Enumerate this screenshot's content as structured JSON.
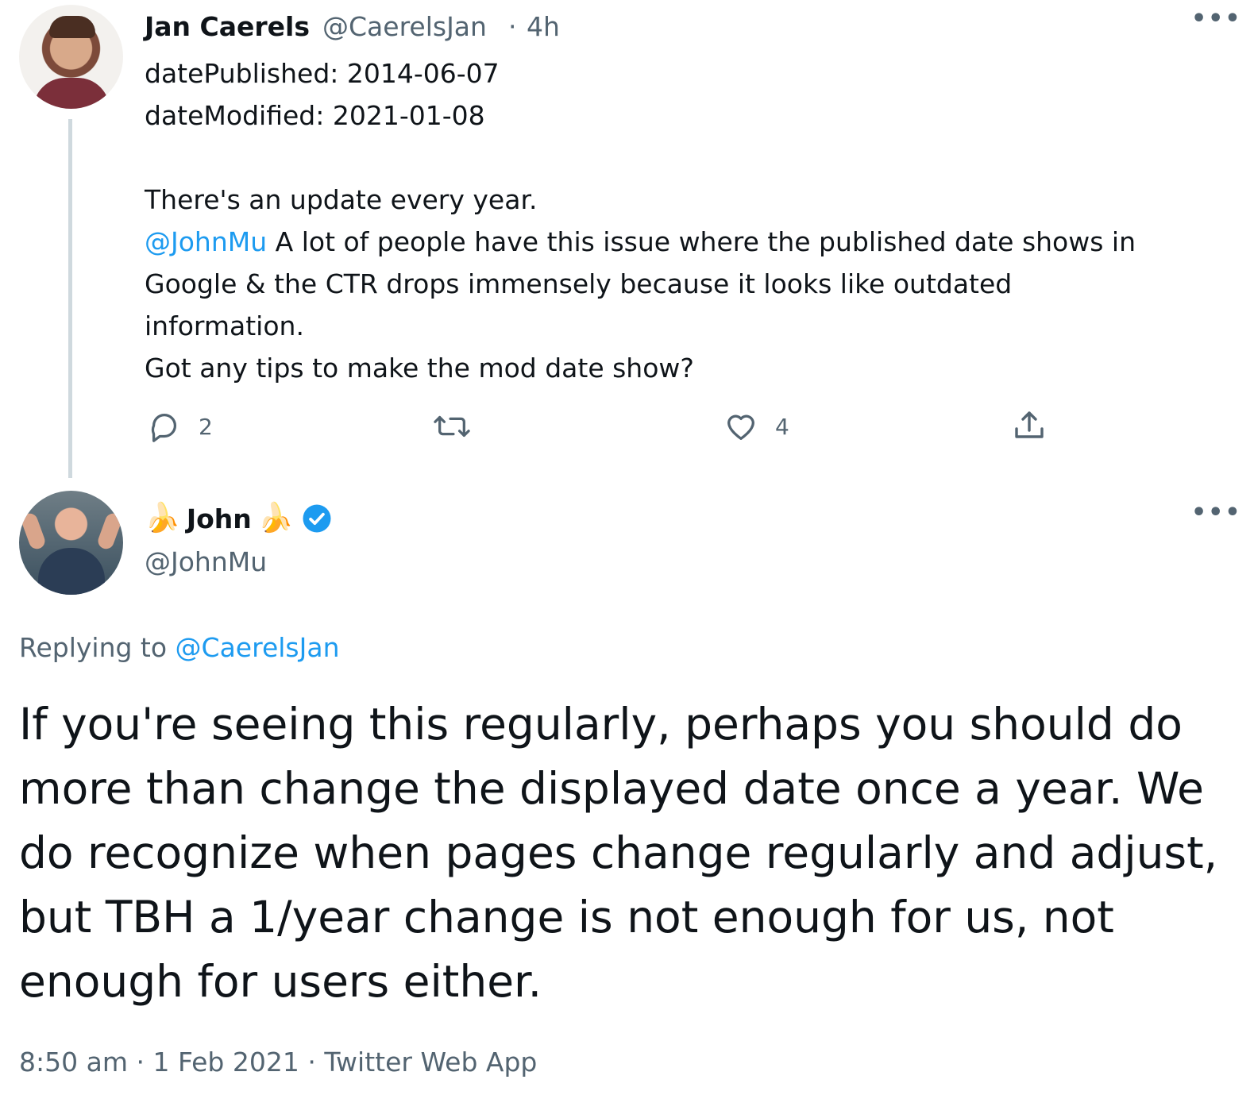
{
  "parent_tweet": {
    "author_name": "Jan Caerels",
    "author_handle": "@CaerelsJan",
    "separator": "·",
    "time_ago": "4h",
    "more_label": "•••",
    "lines": [
      "datePublished: 2014-06-07",
      "dateModified: 2021-01-08",
      "There's an update every year.",
      "A lot of people have this issue where the published date shows in",
      "Google & the CTR drops immensely because it looks like outdated",
      "information.",
      "Got any tips to make the mod date show?"
    ],
    "mention": "@JohnMu",
    "reply_count": "2",
    "like_count": "4"
  },
  "main_tweet": {
    "banana_emoji": "🍌",
    "author_name": "John",
    "author_handle": "@JohnMu",
    "more_label": "•••",
    "replying_to_label": "Replying to",
    "replying_to_handle": "@CaerelsJan",
    "text_lines": [
      "If you're seeing this regularly, perhaps you should do",
      "more than change the displayed date once a year. We",
      "do recognize when pages change regularly and adjust,",
      "but TBH a 1/year change is not enough for us, not",
      "enough for users either."
    ],
    "time": "8:50 am",
    "date": "1 Feb 2021",
    "source": "Twitter Web App",
    "separator": "·"
  },
  "colors": {
    "link_blue": "#1d9bf0",
    "secondary_grey": "#536471",
    "thread_line": "#cfd9de",
    "text": "#0f1419"
  },
  "icons": [
    "reply-icon",
    "retweet-icon",
    "like-icon",
    "share-icon",
    "verified-badge-icon",
    "more-icon"
  ]
}
